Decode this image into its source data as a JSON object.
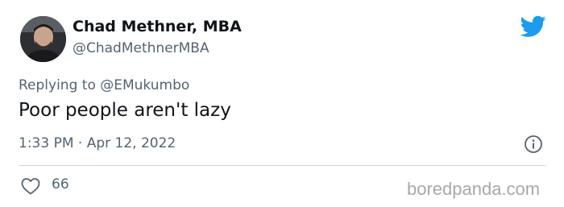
{
  "author": {
    "display_name": "Chad Methner, MBA",
    "handle": "@ChadMethnerMBA"
  },
  "reply": {
    "prefix": "Replying to ",
    "mention": "@EMukumbo"
  },
  "tweet": {
    "text": "Poor people aren't lazy",
    "timestamp": "1:33 PM · Apr 12, 2022"
  },
  "engagement": {
    "likes": "66"
  },
  "watermark": "boredpanda.com",
  "colors": {
    "twitter_blue": "#1d9bf0",
    "secondary_text": "#536471",
    "primary_text": "#0f1419",
    "divider": "#cfd9de",
    "watermark": "#a8a8a8"
  },
  "icons": {
    "brand": "twitter-bird-icon",
    "info": "info-icon",
    "like": "heart-icon"
  }
}
